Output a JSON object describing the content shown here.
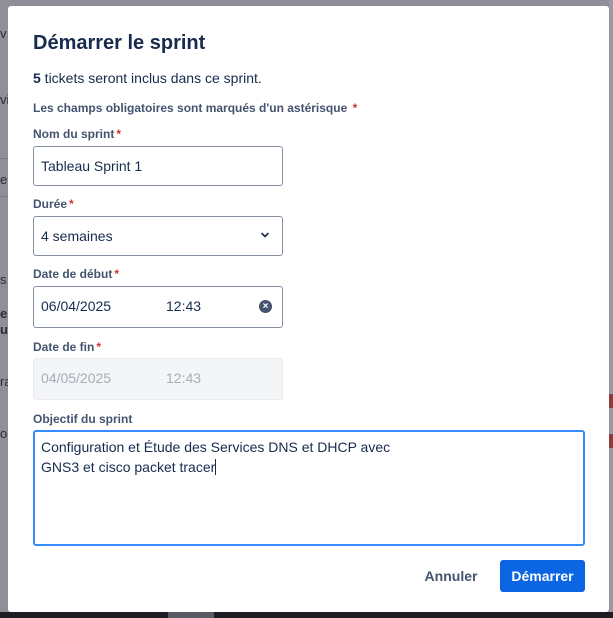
{
  "background": {
    "fragments": [
      {
        "text": "v",
        "id": "frag-chevron"
      },
      {
        "text": "vi",
        "id": "frag-1"
      },
      {
        "text": "e",
        "id": "frag-2"
      },
      {
        "text": "s e",
        "id": "frag-3"
      },
      {
        "text": "e",
        "id": "frag-4"
      },
      {
        "text": "u",
        "id": "frag-5"
      },
      {
        "text": "ra",
        "id": "frag-6"
      },
      {
        "text": "oi",
        "id": "frag-7"
      },
      {
        "text": "e",
        "id": "frag-8"
      }
    ]
  },
  "modal": {
    "title": "Démarrer le sprint",
    "info_count": "5",
    "info_text": " tickets seront inclus dans ce sprint.",
    "required_note": "Les champs obligatoires sont marqués d'un astérisque",
    "required_star": "*",
    "fields": {
      "sprint_name": {
        "label": "Nom du sprint",
        "value": "Tableau Sprint 1"
      },
      "duration": {
        "label": "Durée",
        "value": "4 semaines"
      },
      "start_date": {
        "label": "Date de début",
        "date": "06/04/2025",
        "time": "12:43"
      },
      "end_date": {
        "label": "Date de fin",
        "date": "04/05/2025",
        "time": "12:43"
      },
      "goal": {
        "label": "Objectif du sprint",
        "value": "Configuration et Étude des Services DNS et DHCP avec\nGNS3 et cisco packet tracer"
      }
    },
    "buttons": {
      "cancel": "Annuler",
      "start": "Démarrer"
    }
  },
  "colors": {
    "primary": "#0c66e4",
    "focus": "#388bff",
    "required": "#c9372c"
  }
}
